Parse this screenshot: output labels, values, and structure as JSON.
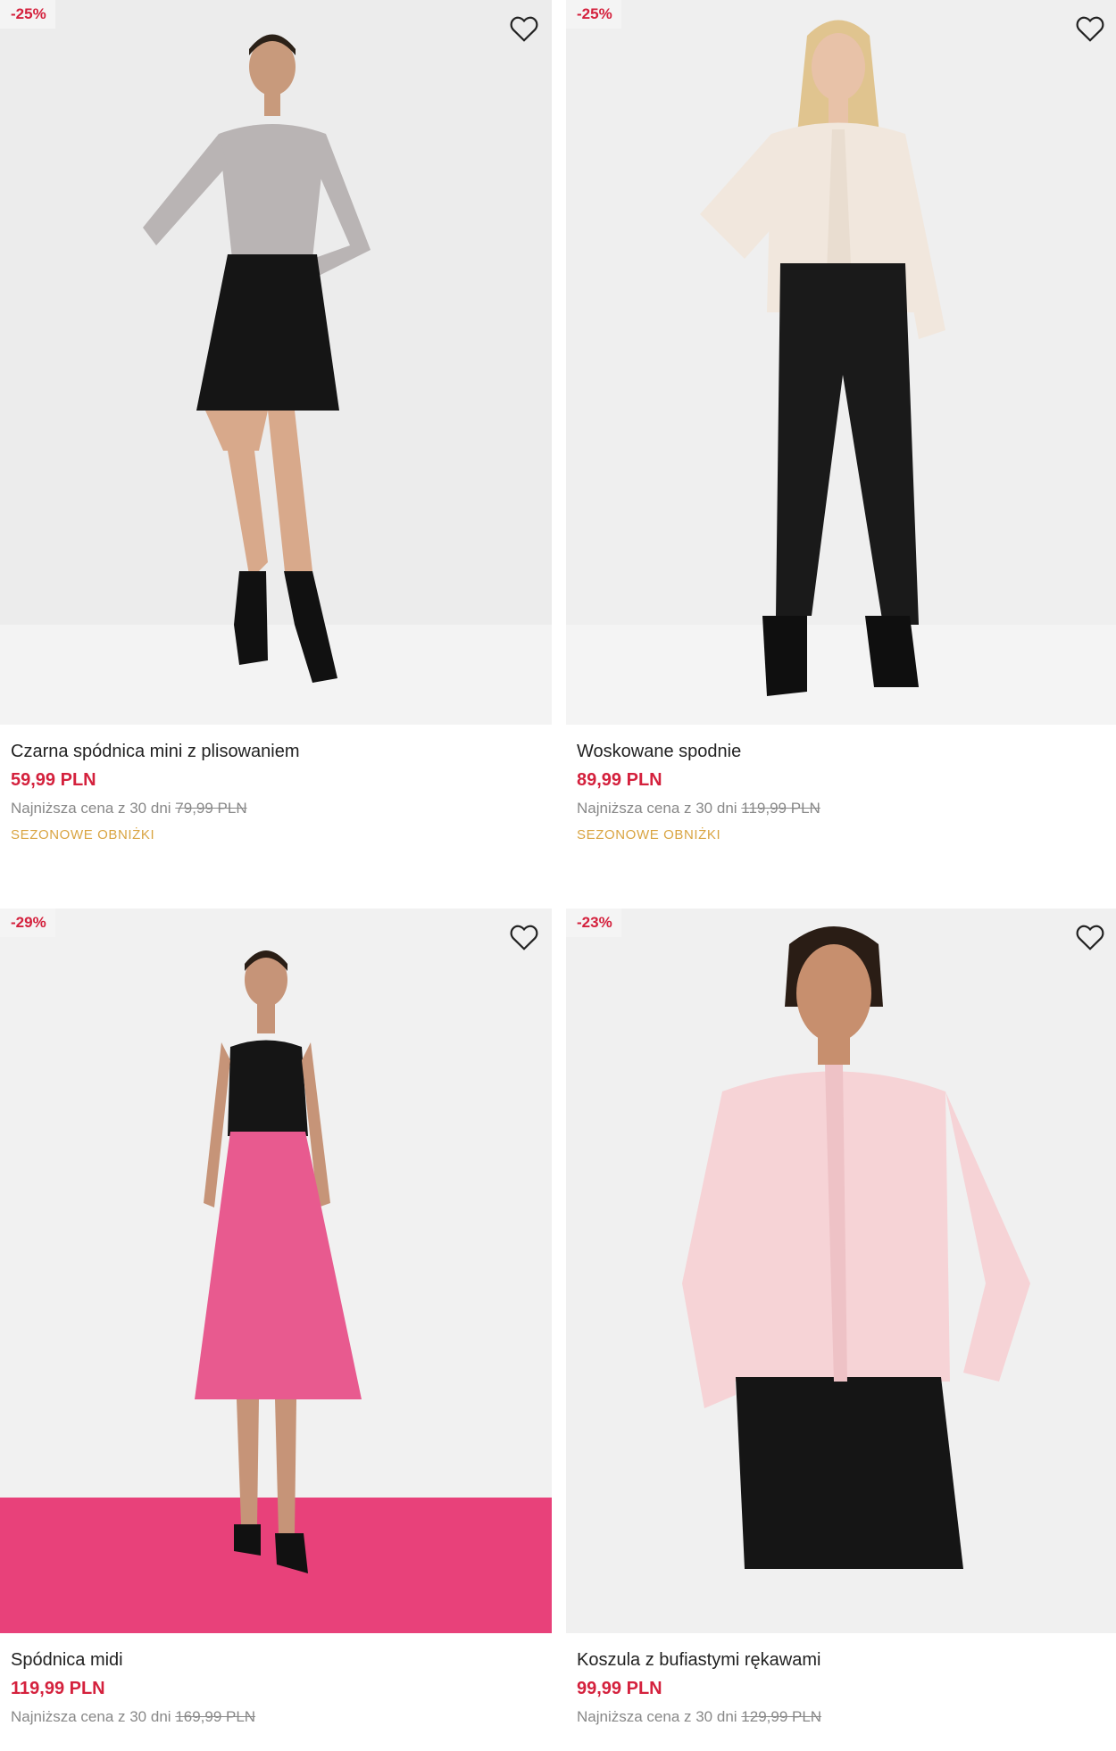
{
  "products": [
    {
      "discount": "-25%",
      "name": "Czarna spódnica mini z plisowaniem",
      "price": "59,99 PLN",
      "lowest_label": "Najniższa cena z 30 dni",
      "old_price": "79,99 PLN",
      "promo": "SEZONOWE OBNIŻKI",
      "favorite_icon": "heart-outline-icon"
    },
    {
      "discount": "-25%",
      "name": "Woskowane spodnie",
      "price": "89,99 PLN",
      "lowest_label": "Najniższa cena z 30 dni",
      "old_price": "119,99 PLN",
      "promo": "SEZONOWE OBNIŻKI",
      "favorite_icon": "heart-outline-icon"
    },
    {
      "discount": "-29%",
      "name": "Spódnica midi",
      "price": "119,99 PLN",
      "lowest_label": "Najniższa cena z 30 dni",
      "old_price": "169,99 PLN",
      "favorite_icon": "heart-outline-icon"
    },
    {
      "discount": "-23%",
      "name": "Koszula z bufiastymi rękawami",
      "price": "99,99 PLN",
      "lowest_label": "Najniższa cena z 30 dni",
      "old_price": "129,99 PLN",
      "favorite_icon": "heart-outline-icon"
    }
  ],
  "colors": {
    "discount": "#d4213d",
    "price": "#d4213d",
    "promo": "#d9a441",
    "muted": "#888888"
  }
}
